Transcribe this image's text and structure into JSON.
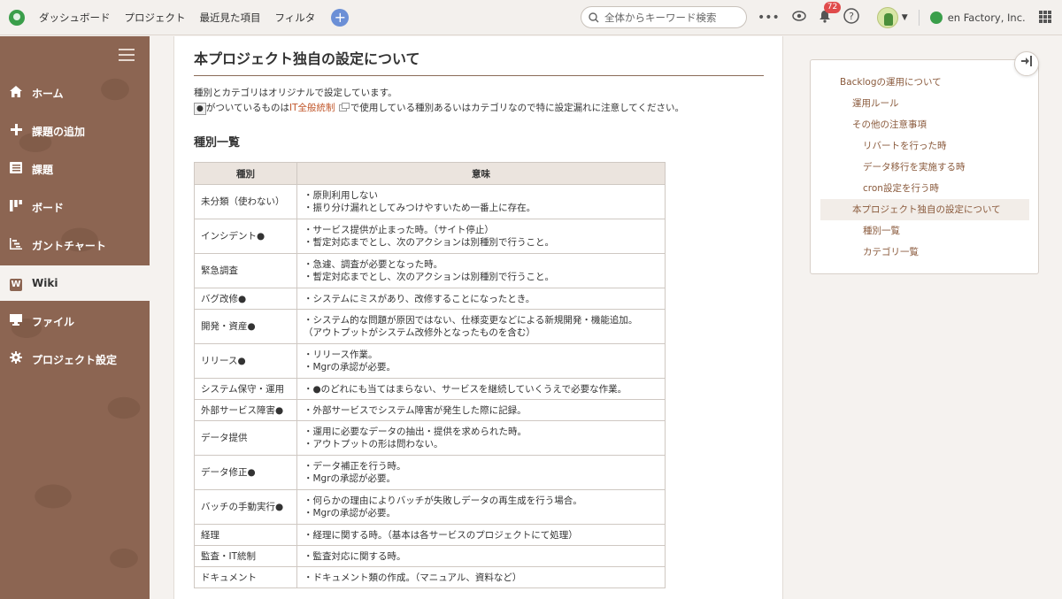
{
  "topbar": {
    "nav": [
      "ダッシュボード",
      "プロジェクト",
      "最近見た項目",
      "フィルタ"
    ],
    "add_label": "+",
    "search_placeholder": "全体からキーワード検索",
    "more": "•••",
    "notification_count": "72",
    "company": "en Factory, Inc."
  },
  "sidebar": {
    "items": [
      {
        "label": "ホーム",
        "icon": "home-icon"
      },
      {
        "label": "課題の追加",
        "icon": "plus-icon"
      },
      {
        "label": "課題",
        "icon": "list-icon"
      },
      {
        "label": "ボード",
        "icon": "board-icon"
      },
      {
        "label": "ガントチャート",
        "icon": "gantt-icon"
      },
      {
        "label": "Wiki",
        "icon": "wiki-icon"
      },
      {
        "label": "ファイル",
        "icon": "file-icon"
      },
      {
        "label": "プロジェクト設定",
        "icon": "gear-icon"
      }
    ],
    "active": "Wiki"
  },
  "main": {
    "heading": "本プロジェクト独自の設定について",
    "para1": "種別とカテゴリはオリジナルで設定しています。",
    "para2_dot": "●",
    "para2_a": "がついているものは",
    "para2_link": "IT全般統制",
    "para2_b": "で使用している種別あるいはカテゴリなので特に設定漏れに注意してください。",
    "subheading": "種別一覧",
    "table": {
      "headers": [
        "種別",
        "意味"
      ],
      "rows": [
        [
          "未分類（使わない）",
          "・原則利用しない\n・振り分け漏れとしてみつけやすいため一番上に存在。"
        ],
        [
          "インシデント●",
          "・サービス提供が止まった時。（サイト停止）\n・暫定対応までとし、次のアクションは別種別で行うこと。"
        ],
        [
          "緊急調査",
          "・急遽、調査が必要となった時。\n・暫定対応までとし、次のアクションは別種別で行うこと。"
        ],
        [
          "バグ改修●",
          "・システムにミスがあり、改修することになったとき。"
        ],
        [
          "開発・資産●",
          "・システム的な問題が原因ではない、仕様変更などによる新規開発・機能追加。\n（アウトプットがシステム改修外となったものを含む）"
        ],
        [
          "リリース●",
          "・リリース作業。\n・Mgrの承認が必要。"
        ],
        [
          "システム保守・運用",
          "・●のどれにも当てはまらない、サービスを継続していくうえで必要な作業。"
        ],
        [
          "外部サービス障害●",
          "・外部サービスでシステム障害が発生した際に記録。"
        ],
        [
          "データ提供",
          "・運用に必要なデータの抽出・提供を求められた時。\n・アウトプットの形は問わない。"
        ],
        [
          "データ修正●",
          "・データ補正を行う時。\n・Mgrの承認が必要。"
        ],
        [
          "バッチの手動実行●",
          "・何らかの理由によりバッチが失敗しデータの再生成を行う場合。\n・Mgrの承認が必要。"
        ],
        [
          "経理",
          "・経理に関する時。（基本は各サービスのプロジェクトにて処理）"
        ],
        [
          "監査・IT統制",
          "・監査対応に関する時。"
        ],
        [
          "ドキュメント",
          "・ドキュメント類の作成。（マニュアル、資料など）"
        ]
      ]
    }
  },
  "toc": {
    "items": [
      {
        "label": "Backlogの運用について",
        "level": 1
      },
      {
        "label": "運用ルール",
        "level": 2
      },
      {
        "label": "その他の注意事項",
        "level": 2
      },
      {
        "label": "リバートを行った時",
        "level": 3
      },
      {
        "label": "データ移行を実施する時",
        "level": 3
      },
      {
        "label": "cron設定を行う時",
        "level": 3
      },
      {
        "label": "本プロジェクト独自の設定について",
        "level": 2
      },
      {
        "label": "種別一覧",
        "level": 3
      },
      {
        "label": "カテゴリ一覧",
        "level": 3
      }
    ],
    "selected": "本プロジェクト独自の設定について"
  },
  "colors": {
    "sidebar": "#8c6552",
    "accent": "#c1572b",
    "toc_link": "#8a5a3c"
  }
}
